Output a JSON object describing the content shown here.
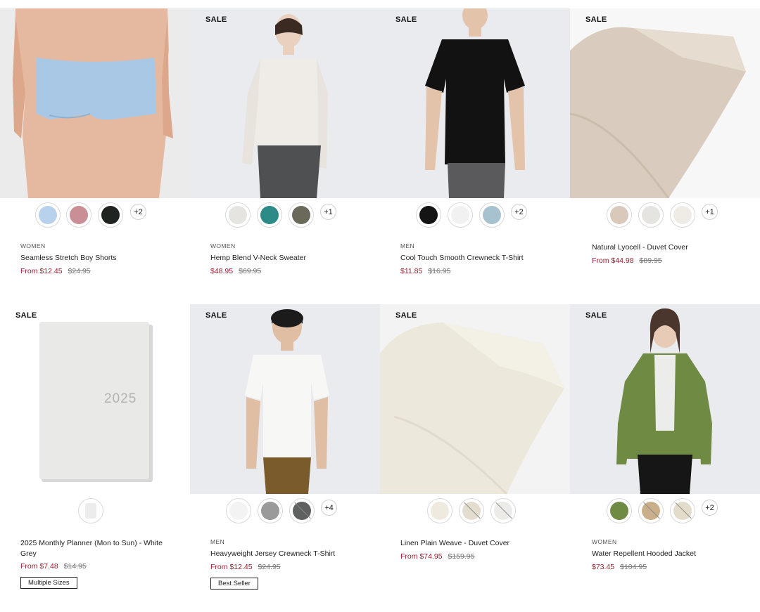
{
  "colors": {
    "sale_price": "#9a1b2e",
    "image_bg": "#e9ebee"
  },
  "products": [
    {
      "sale_badge": "",
      "category": "WOMEN",
      "name": "Seamless Stretch Boy Shorts",
      "price": "From $12.45",
      "original_price": "$24.95",
      "swatches": [
        "light-blue",
        "pink",
        "black"
      ],
      "more_colors": "+2",
      "tag": ""
    },
    {
      "sale_badge": "SALE",
      "category": "WOMEN",
      "name": "Hemp Blend V-Neck Sweater",
      "price": "$48.95",
      "original_price": "$69.95",
      "swatches": [
        "off-white",
        "teal",
        "olive"
      ],
      "more_colors": "+1",
      "tag": ""
    },
    {
      "sale_badge": "SALE",
      "category": "MEN",
      "name": "Cool Touch Smooth Crewneck T-Shirt",
      "price": "$11.85",
      "original_price": "$16.95",
      "swatches": [
        "black",
        "white",
        "light-blue"
      ],
      "more_colors": "+2",
      "tag": ""
    },
    {
      "sale_badge": "SALE",
      "category": "",
      "name": "Natural Lyocell - Duvet Cover",
      "price": "From $44.98",
      "original_price": "$89.95",
      "swatches": [
        "beige",
        "light-grey",
        "ivory"
      ],
      "more_colors": "+1",
      "tag": ""
    },
    {
      "sale_badge": "SALE",
      "category": "",
      "name": "2025 Monthly Planner (Mon to Sun) - White Grey",
      "price": "From $7.48",
      "original_price": "$14.95",
      "planner_cover_text": "2025",
      "swatches": [
        "white-grey"
      ],
      "more_colors": "",
      "tag": "Multiple Sizes"
    },
    {
      "sale_badge": "SALE",
      "category": "MEN",
      "name": "Heavyweight Jersey Crewneck T-Shirt",
      "price": "From $12.45",
      "original_price": "$24.95",
      "swatches": [
        "white",
        "grey",
        "charcoal"
      ],
      "more_colors": "+4",
      "tag": "Best Seller"
    },
    {
      "sale_badge": "SALE",
      "category": "",
      "name": "Linen Plain Weave - Duvet Cover",
      "price": "From $74.95",
      "original_price": "$159.95",
      "swatches": [
        "ivory",
        "oatmeal",
        "white"
      ],
      "more_colors": "",
      "tag": ""
    },
    {
      "sale_badge": "SALE",
      "category": "WOMEN",
      "name": "Water Repellent Hooded Jacket",
      "price": "$73.45",
      "original_price": "$104.95",
      "swatches": [
        "khaki-green",
        "beige",
        "light-beige"
      ],
      "more_colors": "+2",
      "tag": ""
    }
  ]
}
